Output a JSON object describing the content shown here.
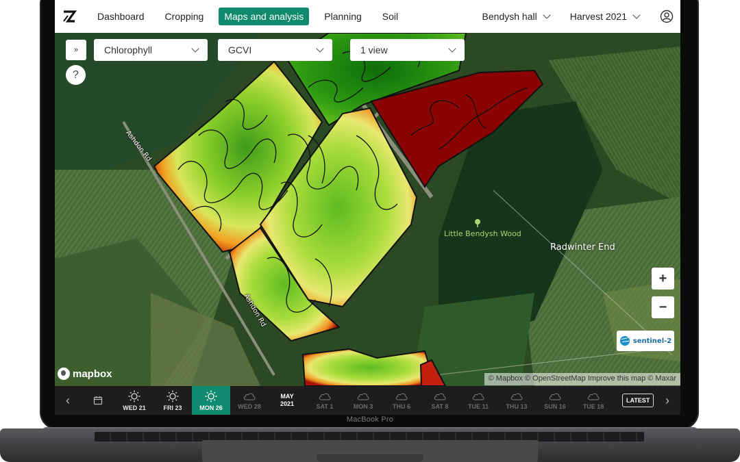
{
  "app": {
    "logo": "Z",
    "brand_color": "#0f8a6e"
  },
  "nav": {
    "items": [
      {
        "label": "Dashboard",
        "active": false
      },
      {
        "label": "Cropping",
        "active": false
      },
      {
        "label": "Maps and analysis",
        "active": true
      },
      {
        "label": "Planning",
        "active": false
      },
      {
        "label": "Soil",
        "active": false
      }
    ],
    "farm": "Bendysh hall",
    "season": "Harvest 2021",
    "user_icon": "user-circle-icon"
  },
  "toolbar": {
    "collapse_icon": "»",
    "help_label": "?",
    "layer_select": "Chlorophyll",
    "index_select": "GCVI",
    "view_select": "1 view"
  },
  "map": {
    "labels": {
      "wood": "Little Bendysh Wood",
      "town": "Radwinter End",
      "road_1": "Ashdon Rd",
      "road_2": "Ashdon Rd"
    },
    "zoom_in": "+",
    "zoom_out": "−",
    "sentinel": "sentinel-2",
    "mapbox": "mapbox",
    "attribution": "© Mapbox © OpenStreetMap Improve this map © Maxar"
  },
  "timeline": {
    "prev": "‹",
    "next": "›",
    "days": [
      {
        "label": "WED 21",
        "weather": "sun",
        "active": false
      },
      {
        "label": "FRI 23",
        "weather": "sun",
        "active": false
      },
      {
        "label": "MON 26",
        "weather": "sun",
        "active": true
      },
      {
        "label": "WED 28",
        "weather": "cloud",
        "active": false
      }
    ],
    "month": {
      "line1": "MAY",
      "line2": "2021"
    },
    "days2": [
      {
        "label": "SAT 1",
        "weather": "cloud"
      },
      {
        "label": "MON 3",
        "weather": "cloud"
      },
      {
        "label": "THU 6",
        "weather": "cloud"
      },
      {
        "label": "SAT 8",
        "weather": "cloud"
      },
      {
        "label": "TUE 11",
        "weather": "cloud"
      },
      {
        "label": "THU 13",
        "weather": "cloud"
      },
      {
        "label": "SUN 16",
        "weather": "cloud"
      },
      {
        "label": "TUE 18",
        "weather": "cloud"
      }
    ],
    "latest": "LATEST"
  },
  "device": {
    "label": "MacBook Pro"
  }
}
